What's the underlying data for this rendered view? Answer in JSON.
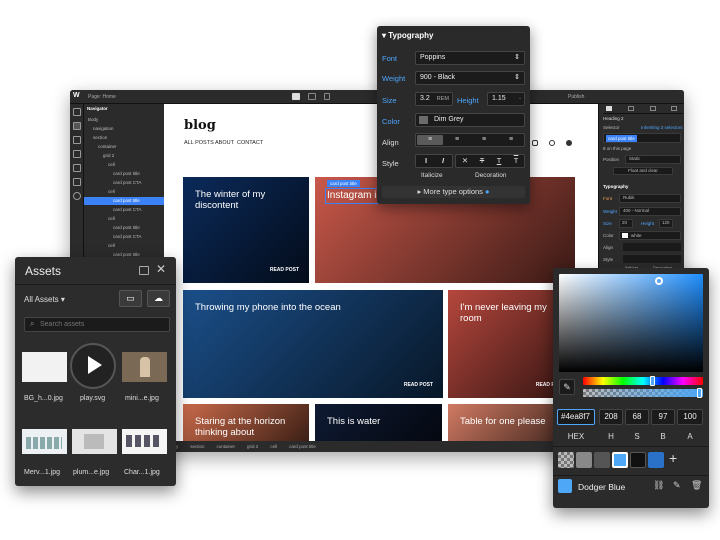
{
  "designer": {
    "topbar": {
      "page_label": "Page: Home",
      "publish": "Publish"
    },
    "navigator": {
      "title": "Navigator",
      "items": [
        {
          "label": "Body",
          "depth": 0,
          "selected": false
        },
        {
          "label": "navigation",
          "depth": 1,
          "selected": false
        },
        {
          "label": "section",
          "depth": 1,
          "selected": false
        },
        {
          "label": "container",
          "depth": 2,
          "selected": false
        },
        {
          "label": "grid 2",
          "depth": 3,
          "selected": false
        },
        {
          "label": "cell",
          "depth": 4,
          "selected": false
        },
        {
          "label": "card post title",
          "depth": 5,
          "selected": false
        },
        {
          "label": "card post CTA",
          "depth": 5,
          "selected": false
        },
        {
          "label": "cell",
          "depth": 4,
          "selected": false
        },
        {
          "label": "card post title",
          "depth": 5,
          "selected": true
        },
        {
          "label": "card post CTA",
          "depth": 5,
          "selected": false
        },
        {
          "label": "cell",
          "depth": 4,
          "selected": false
        },
        {
          "label": "card post title",
          "depth": 5,
          "selected": false
        },
        {
          "label": "card post CTA",
          "depth": 5,
          "selected": false
        },
        {
          "label": "cell",
          "depth": 4,
          "selected": false
        },
        {
          "label": "card post title",
          "depth": 5,
          "selected": false
        },
        {
          "label": "card post CTA",
          "depth": 5,
          "selected": false
        }
      ]
    },
    "canvas": {
      "blog_title": "blog",
      "nav": [
        "ALL POSTS",
        "ABOUT",
        "CONTACT"
      ],
      "selected_tag": "card post title",
      "cards": [
        {
          "title": "The winter of my discontent",
          "cta": "READ POST",
          "color": "#0b2a5a"
        },
        {
          "title": "Instagram is...",
          "cta": "",
          "color": "#c9584a"
        },
        {
          "title": "Throwing my phone into the ocean",
          "cta": "READ POST",
          "color": "#1b4f8a"
        },
        {
          "title": "I'm never leaving my room",
          "cta": "READ POST",
          "color": "#b5473d"
        },
        {
          "title": "Staring at the horizon thinking about",
          "cta": "",
          "color": "#c96a4a"
        },
        {
          "title": "This is water",
          "cta": "",
          "color": "#0e1a33"
        },
        {
          "title": "Table for one please",
          "cta": "",
          "color": "#d07a62"
        }
      ],
      "breadcrumb": [
        "Body",
        "section",
        "container",
        "grid 2",
        "cell",
        "card post title"
      ]
    },
    "right_panel": {
      "heading": "Heading 2",
      "selector_label": "Selector",
      "inheriting": "Inheriting 3 selectors",
      "selected_class": "card post title",
      "on_page": "8 on this page",
      "position_label": "Position",
      "position_value": "Static",
      "float_clear": "Float and clear",
      "typography": "Typography",
      "font_label": "Font",
      "font_value": "Rubik",
      "weight_label": "Weight",
      "weight_value": "400 - Normal",
      "size_label": "Size",
      "size_value": "20",
      "height_label": "Height",
      "height_value": "120",
      "color_label": "Color",
      "color_value": "white",
      "align_label": "Align",
      "style_label": "Style",
      "italicize": "Italicize",
      "decoration": "Decoration",
      "more": "More type options"
    }
  },
  "typography_panel": {
    "title": "Typography",
    "font_label": "Font",
    "font_value": "Poppins",
    "weight_label": "Weight",
    "weight_value": "900 - Black",
    "size_label": "Size",
    "size_value": "3.2",
    "size_unit": "REM",
    "height_label": "Height",
    "height_value": "1.15",
    "color_label": "Color",
    "color_value": "Dim Grey",
    "align_label": "Align",
    "style_label": "Style",
    "italicize": "Italicize",
    "decoration": "Decoration",
    "more": "More type options"
  },
  "assets": {
    "title": "Assets",
    "filter": "All Assets",
    "search_placeholder": "Search assets",
    "items": [
      {
        "name": "BG_h...0.jpg"
      },
      {
        "name": "play.svg"
      },
      {
        "name": "mini...e.jpg"
      },
      {
        "name": "Merv...1.jpg"
      },
      {
        "name": "plum...e.jpg"
      },
      {
        "name": "Char...1.jpg"
      }
    ]
  },
  "color_picker": {
    "hex": "#4ea8f7",
    "r": "208",
    "g": "68",
    "b": "97",
    "a": "100",
    "labels": [
      "HEX",
      "H",
      "S",
      "B",
      "A"
    ],
    "swatch_name": "Dodger Blue",
    "swatches": [
      "#ffffff",
      "#888888",
      "#555555",
      "#4ea8f7",
      "#111111",
      "#2a72c8"
    ]
  }
}
